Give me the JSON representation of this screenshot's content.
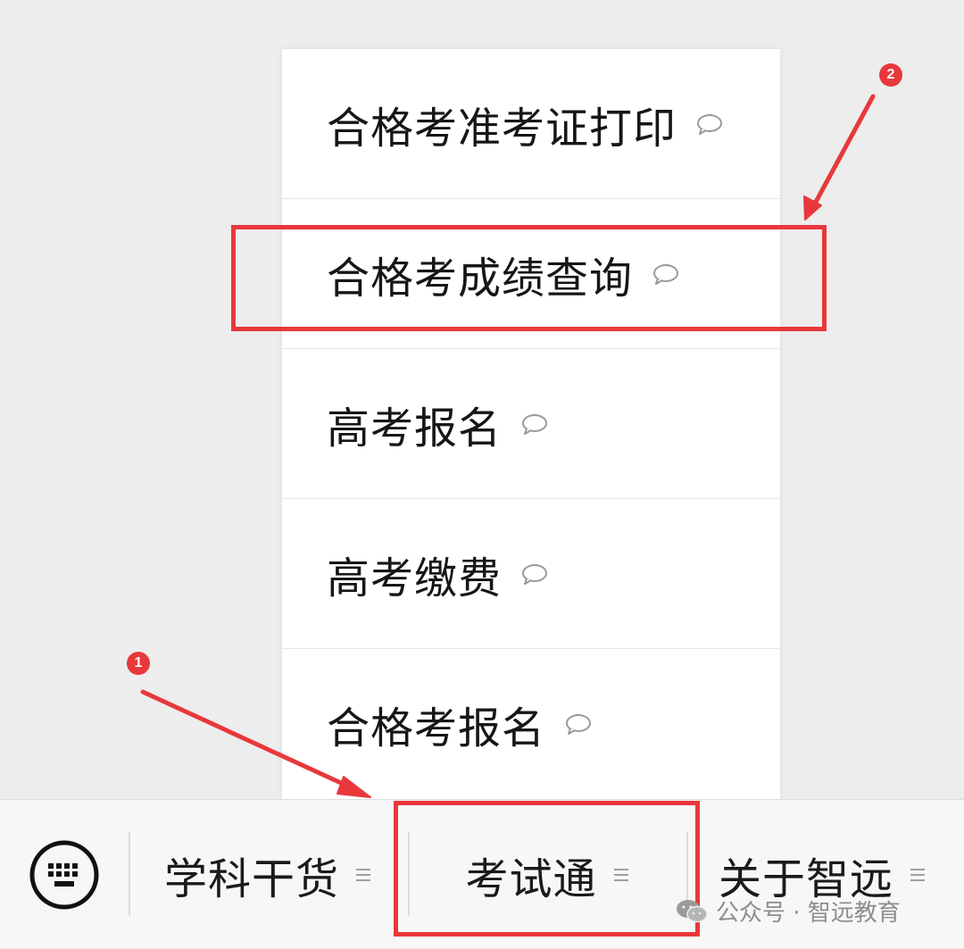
{
  "menu": {
    "items": [
      {
        "label": "合格考准考证打印",
        "icon": "chat-bubble-icon"
      },
      {
        "label": "合格考成绩查询",
        "icon": "chat-bubble-icon"
      },
      {
        "label": "高考报名",
        "icon": "chat-bubble-icon"
      },
      {
        "label": "高考缴费",
        "icon": "chat-bubble-icon"
      },
      {
        "label": "合格考报名",
        "icon": "chat-bubble-icon"
      }
    ]
  },
  "bottom_bar": {
    "keyboard_icon": "keyboard-icon",
    "tabs": [
      {
        "label": "学科干货",
        "icon": "menu-lines-icon"
      },
      {
        "label": "考试通",
        "icon": "menu-lines-icon"
      },
      {
        "label": "关于智远",
        "icon": "menu-lines-icon"
      }
    ]
  },
  "annotations": {
    "badge_1": "1",
    "badge_2": "2",
    "highlight_color": "#e8383b"
  },
  "watermark": {
    "text": "公众号 · 智远教育",
    "icon": "wechat-icon"
  },
  "colors": {
    "background": "#ededed",
    "menu_background": "#ffffff",
    "accent": "#e8383b"
  }
}
